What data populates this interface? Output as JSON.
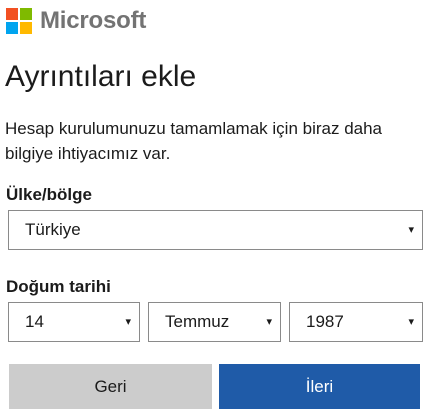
{
  "brand": {
    "name": "Microsoft",
    "logo_colors": [
      "#f25022",
      "#7fba00",
      "#00a4ef",
      "#ffb900"
    ]
  },
  "title": "Ayrıntıları ekle",
  "description": "Hesap kurulumunuzu tamamlamak için biraz daha bilgiye ihtiyacımız var.",
  "country": {
    "label": "Ülke/bölge",
    "value": "Türkiye"
  },
  "birthdate": {
    "label": "Doğum tarihi",
    "day": "14",
    "month": "Temmuz",
    "year": "1987"
  },
  "icons": {
    "caret": "▾"
  },
  "buttons": {
    "back": "Geri",
    "next": "İleri"
  },
  "colors": {
    "primary": "#1f5ba8",
    "secondary": "#cccccc"
  }
}
